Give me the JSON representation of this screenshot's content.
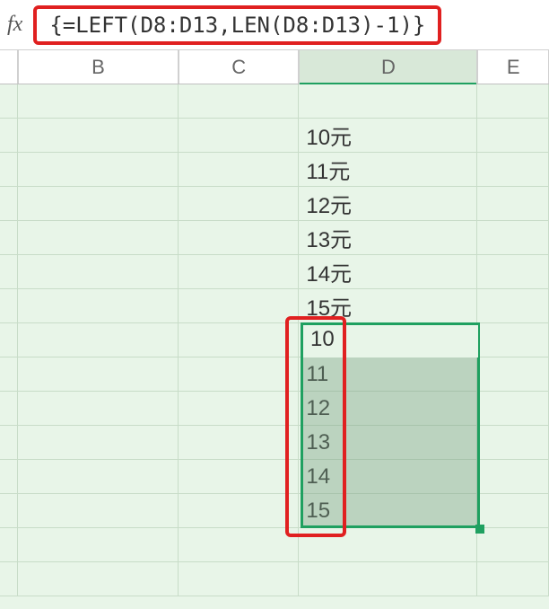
{
  "formula_bar": {
    "fx_label": "fx",
    "formula": "{=LEFT(D8:D13,LEN(D8:D13)-1)}"
  },
  "columns": {
    "A": "",
    "B": "B",
    "C": "C",
    "D": "D",
    "E": "E"
  },
  "rows": [
    {
      "D": ""
    },
    {
      "D": "10元"
    },
    {
      "D": "11元"
    },
    {
      "D": "12元"
    },
    {
      "D": "13元"
    },
    {
      "D": "14元"
    },
    {
      "D": "15元"
    },
    {
      "D": "10"
    },
    {
      "D": "11"
    },
    {
      "D": "12"
    },
    {
      "D": "13"
    },
    {
      "D": "14"
    },
    {
      "D": "15"
    },
    {
      "D": ""
    },
    {
      "D": ""
    }
  ],
  "chart_data": {
    "type": "table",
    "title": "Excel array formula LEFT/LEN stripping trailing character",
    "source_range": "D8:D13",
    "source_values": [
      "10元",
      "11元",
      "12元",
      "13元",
      "14元",
      "15元"
    ],
    "result_range": "D14:D19",
    "result_values": [
      "10",
      "11",
      "12",
      "13",
      "14",
      "15"
    ],
    "formula": "{=LEFT(D8:D13,LEN(D8:D13)-1)}"
  }
}
